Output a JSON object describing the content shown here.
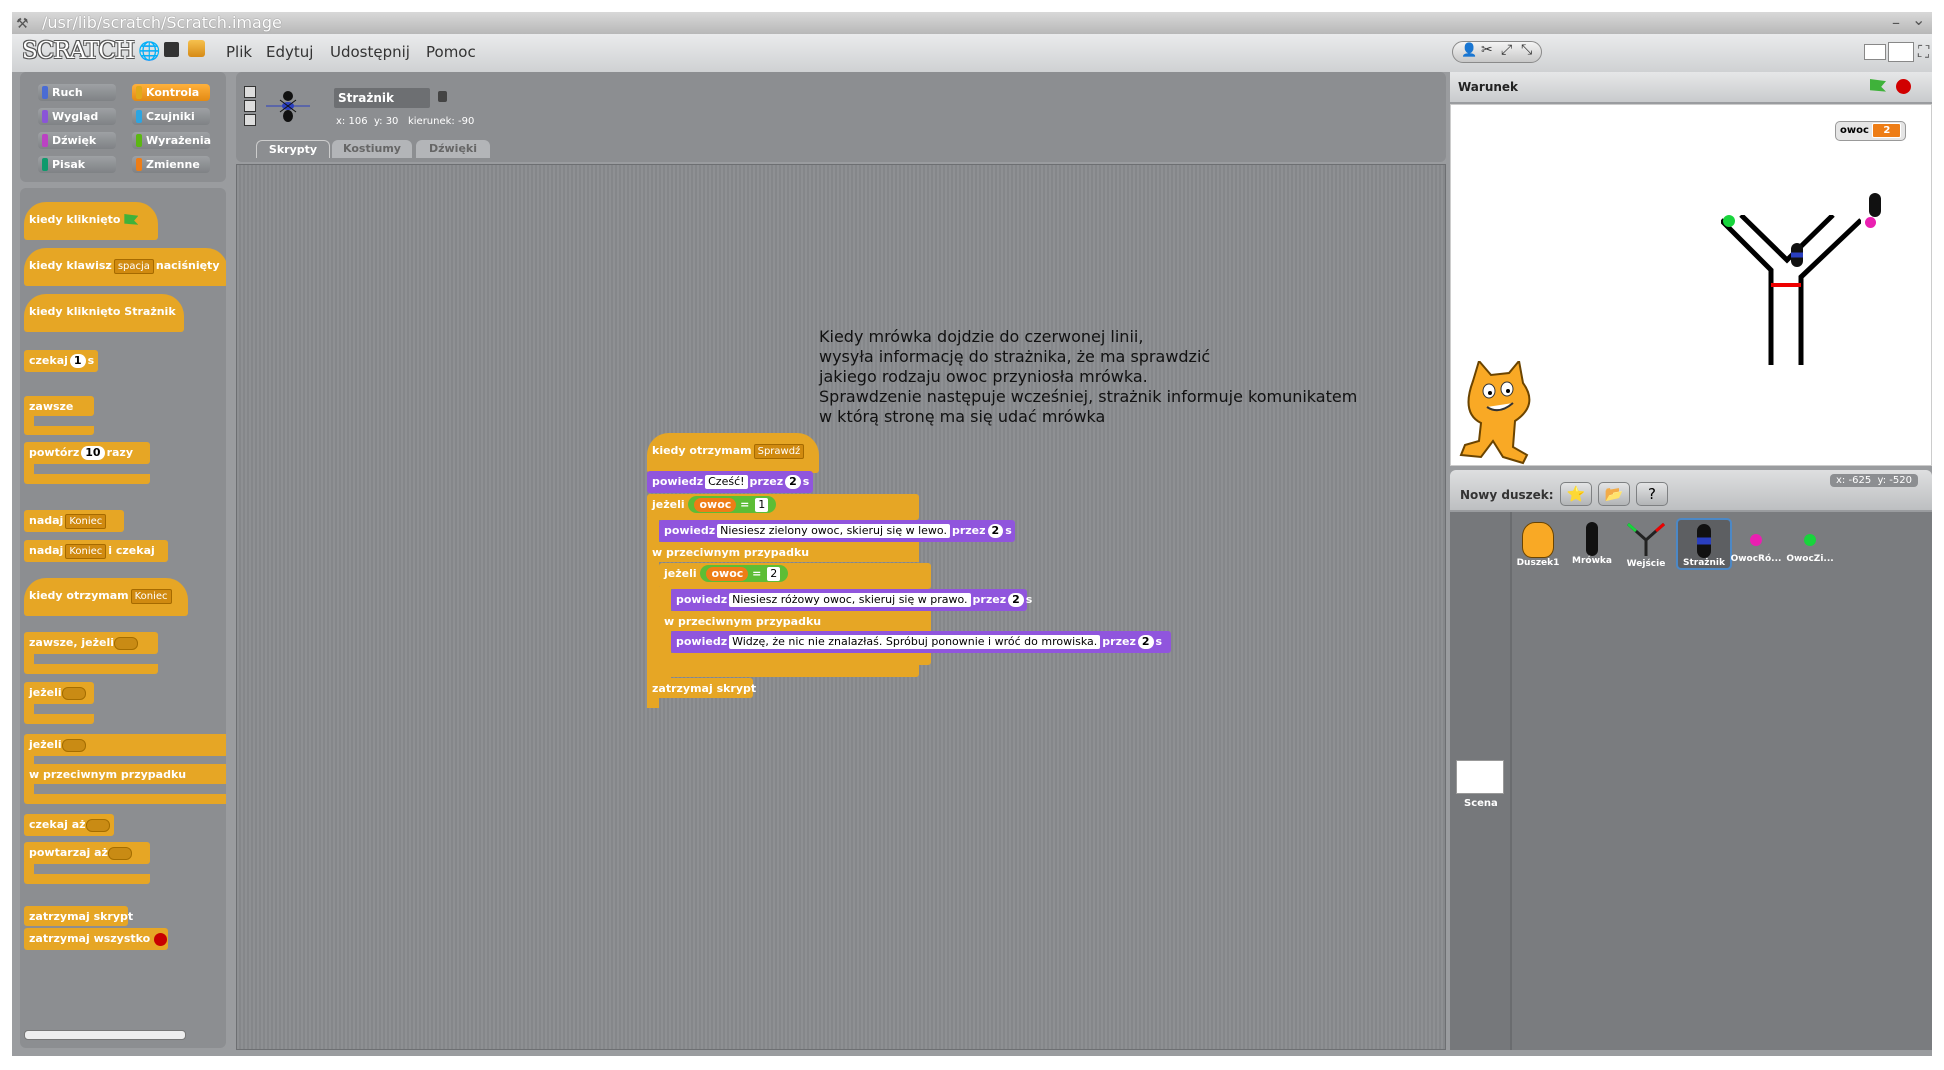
{
  "window": {
    "title": "/usr/lib/scratch/Scratch.image",
    "controls": [
      "–",
      "⌄"
    ]
  },
  "menubar": {
    "logo": "SCRATCH",
    "menus": [
      "Plik",
      "Edytuj",
      "Udostępnij",
      "Pomoc"
    ]
  },
  "categories": [
    {
      "label": "Ruch",
      "color": "#4a6cd4"
    },
    {
      "label": "Kontrola",
      "color": "#e1a91a"
    },
    {
      "label": "Wygląd",
      "color": "#8a55d7"
    },
    {
      "label": "Czujniki",
      "color": "#2ca5e2"
    },
    {
      "label": "Dźwięk",
      "color": "#bb42c3"
    },
    {
      "label": "Wyrażenia",
      "color": "#5cb712"
    },
    {
      "label": "Pisak",
      "color": "#0e9a6c"
    },
    {
      "label": "Zmienne",
      "color": "#ee7d16"
    }
  ],
  "palette": {
    "when_flag": "kiedy kliknięto",
    "when_key": "kiedy klawisz",
    "key_value": "spacja",
    "key_pressed": "naciśnięty",
    "when_clicked": "kiedy kliknięto Strażnik",
    "wait": "czekaj",
    "wait_value": "1",
    "wait_unit": "s",
    "forever": "zawsze",
    "repeat": "powtórz",
    "repeat_value": "10",
    "repeat_unit": "razy",
    "broadcast": "nadaj",
    "broadcast_value": "Koniec",
    "broadcast_wait": "nadaj",
    "broadcast_wait_value": "Koniec",
    "broadcast_wait_suffix": "i czekaj",
    "when_receive": "kiedy otrzymam",
    "when_receive_value": "Koniec",
    "forever_if": "zawsze, jeżeli",
    "if": "jeżeli",
    "if_else_if": "jeżeli",
    "else": "w przeciwnym przypadku",
    "wait_until": "czekaj aż",
    "repeat_until": "powtarzaj aż",
    "stop_script": "zatrzymaj skrypt",
    "stop_all": "zatrzymaj wszystko"
  },
  "sprite_info": {
    "name": "Strażnik",
    "x_label": "x:",
    "x": "106",
    "y_label": "y:",
    "y": "30",
    "direction_label": "kierunek:",
    "direction": "-90"
  },
  "tabs": [
    "Skrypty",
    "Kostiumy",
    "Dźwięki"
  ],
  "comment": [
    "Kiedy mrówka dojdzie do czerwonej linii,",
    "wysyła informację do strażnika, że ma sprawdzić",
    "jakiego rodzaju owoc przyniosła mrówka.",
    "Sprawdzenie następuje wcześniej, strażnik informuje komunikatem",
    "w którą stronę ma się udać mrówka"
  ],
  "script": {
    "hat": "kiedy otrzymam",
    "hat_value": "Sprawdź",
    "say1": "powiedz",
    "say1_text": "Cześć!",
    "say1_for": "przez",
    "say1_secs": "2",
    "say1_unit": "s",
    "if1": "jeżeli",
    "if1_var": "owoc",
    "if1_op": "=",
    "if1_val": "1",
    "say2": "powiedz",
    "say2_text": "Niesiesz zielony owoc, skieruj się w lewo.",
    "say2_for": "przez",
    "say2_secs": "2",
    "say2_unit": "s",
    "else1": "w przeciwnym przypadku",
    "if2": "jeżeli",
    "if2_var": "owoc",
    "if2_op": "=",
    "if2_val": "2",
    "say3": "powiedz",
    "say3_text": "Niesiesz różowy owoc, skieruj się w prawo.",
    "say3_for": "przez",
    "say3_secs": "2",
    "say3_unit": "s",
    "else2": "w przeciwnym przypadku",
    "say4": "powiedz",
    "say4_text": "Widzę, że nic nie znalazłaś. Spróbuj ponownie i wróć do mrowiska.",
    "say4_for": "przez",
    "say4_secs": "2",
    "say4_unit": "s",
    "stop": "zatrzymaj skrypt"
  },
  "stage": {
    "title": "Warunek",
    "var_name": "owoc",
    "var_value": "2"
  },
  "sprites_panel": {
    "new_sprite_label": "Nowy duszek:",
    "mouse_x_label": "x:",
    "mouse_x": "-625",
    "mouse_y_label": "y:",
    "mouse_y": "-520",
    "sprites": [
      "Duszek1",
      "Mrówka",
      "Wejście",
      "Strażnik",
      "OwocRó...",
      "OwocZi..."
    ],
    "stage_label": "Scena"
  }
}
